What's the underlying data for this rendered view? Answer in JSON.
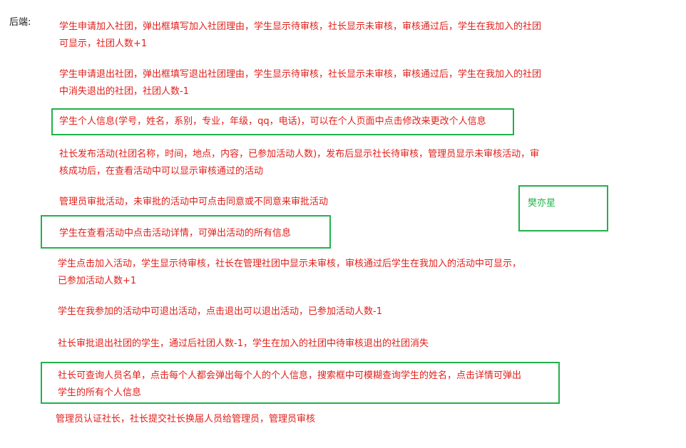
{
  "heading": "后端:",
  "notes": [
    {
      "lines": [
        "学生申请加入社团，弹出框填写加入社团理由，学生显示待审核，社长显示未审核，审核通过后，学生在我加入的社团",
        "可显示，社团人数+1"
      ]
    },
    {
      "lines": [
        "学生申请退出社团，弹出框填写退出社团理由，学生显示待审核，社长显示未审核，审核通过后，学生在我加入的社团",
        "中消失退出的社团，社团人数-1"
      ]
    },
    {
      "lines": [
        "学生个人信息(学号，姓名，系别，专业，年级，qq，电话)，可以在个人页面中点击修改来更改个人信息"
      ]
    },
    {
      "lines": [
        "社长发布活动(社团名称，时间，地点，内容，已参加活动人数)，发布后显示社长待审核，管理员显示未审核活动，审",
        "核成功后，在查看活动中可以显示审核通过的活动"
      ]
    },
    {
      "lines": [
        "管理员审批活动，未审批的活动中可点击同意或不同意来审批活动"
      ]
    },
    {
      "lines": [
        "学生在查看活动中点击活动详情，可弹出活动的所有信息"
      ]
    },
    {
      "lines": [
        "学生点击加入活动，学生显示待审核，社长在管理社团中显示未审核，审核通过后学生在我加入的活动中可显示，",
        "已参加活动人数+1"
      ]
    },
    {
      "lines": [
        "学生在我参加的活动中可退出活动，点击退出可以退出活动，已参加活动人数-1"
      ]
    },
    {
      "lines": [
        "社长审批退出社团的学生，通过后社团人数-1，学生在加入的社团中待审核退出的社团消失"
      ]
    },
    {
      "lines": [
        "社长可查询人员名单，点击每个人都会弹出每个人的个人信息，搜索框中可模糊查询学生的姓名，点击详情可弹出",
        "学生的所有个人信息"
      ]
    },
    {
      "lines": [
        "管理员认证社长，社长提交社长换届人员给管理员，管理员审核"
      ]
    }
  ],
  "name_tag": "樊亦星",
  "colors": {
    "note_text": "#e0201b",
    "highlight_border": "#22b14c",
    "name_text": "#22b14c",
    "heading_text": "#1a1a1a"
  }
}
